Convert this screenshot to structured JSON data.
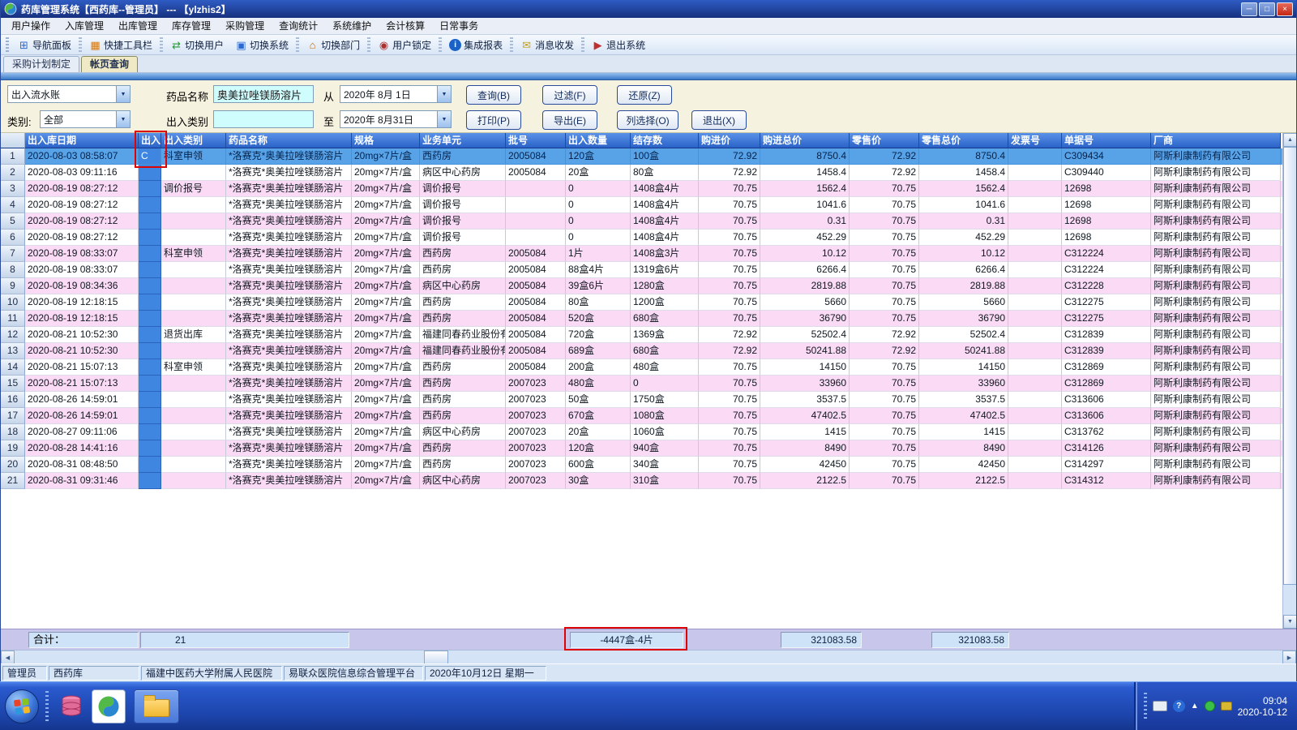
{
  "window": {
    "title": "药库管理系统【西药库--管理员】 --- 【ylzhis2】"
  },
  "icons": {
    "minimize": "─",
    "maximize": "□",
    "close": "×",
    "dropdown": "▼",
    "scroll_up": "▲",
    "scroll_down": "▼",
    "scroll_left": "◀",
    "scroll_right": "▶"
  },
  "menu": {
    "items": [
      "用户操作",
      "入库管理",
      "出库管理",
      "库存管理",
      "采购管理",
      "查询统计",
      "系统维护",
      "会计核算",
      "日常事务"
    ]
  },
  "toolbar": {
    "items": [
      {
        "name": "toolbar-nav-panel",
        "label": "导航面板",
        "icon": "nav-panel-icon",
        "glyph": "⊞",
        "color": "#2a6ad4",
        "circle": false,
        "sep_after": true
      },
      {
        "name": "toolbar-quick-tools",
        "label": "快捷工具栏",
        "icon": "quick-toolbar-icon",
        "glyph": "▦",
        "color": "#d07818",
        "circle": false,
        "sep_after": true
      },
      {
        "name": "toolbar-switch-user",
        "label": "切换用户",
        "icon": "switch-user-icon",
        "glyph": "⇄",
        "color": "#2a9a3a",
        "circle": false,
        "sep_after": false
      },
      {
        "name": "toolbar-switch-system",
        "label": "切换系统",
        "icon": "switch-system-icon",
        "glyph": "▣",
        "color": "#2a6ad4",
        "circle": false,
        "sep_after": true
      },
      {
        "name": "toolbar-switch-dept",
        "label": "切换部门",
        "icon": "switch-dept-icon",
        "glyph": "⌂",
        "color": "#c06a10",
        "circle": false,
        "sep_after": true
      },
      {
        "name": "toolbar-user-lock",
        "label": "用户锁定",
        "icon": "user-lock-icon",
        "glyph": "◉",
        "color": "#b03030",
        "circle": false,
        "sep_after": true
      },
      {
        "name": "toolbar-reports",
        "label": "集成报表",
        "icon": "report-icon",
        "glyph": "i",
        "color": "#1a62c8",
        "circle": true,
        "sep_after": true
      },
      {
        "name": "toolbar-messages",
        "label": "消息收发",
        "icon": "message-icon",
        "glyph": "✉",
        "color": "#c8a018",
        "circle": false,
        "sep_after": true
      },
      {
        "name": "toolbar-exit",
        "label": "退出系统",
        "icon": "exit-icon",
        "glyph": "▶",
        "color": "#c03030",
        "circle": false,
        "sep_after": false
      }
    ]
  },
  "tabs": [
    {
      "label": "采购计划制定",
      "active": false
    },
    {
      "label": "帐页查询",
      "active": true
    }
  ],
  "filters": {
    "ledger_type": "出入流水账",
    "category_label": "类别:",
    "category_value": "全部",
    "drug_name_label": "药品名称",
    "drug_name_value": "奥美拉唑镁肠溶片",
    "inout_type_label": "出入类别",
    "inout_type_value": "",
    "from_label": "从",
    "from_date": "2020年  8月 1日",
    "to_label": "至",
    "to_date": "2020年  8月31日",
    "buttons_row1": [
      "查询(B)",
      "过滤(F)",
      "还原(Z)"
    ],
    "buttons_row2": [
      "打印(P)",
      "导出(E)",
      "列选择(O)",
      "退出(X)"
    ]
  },
  "table": {
    "columns": [
      "出入库日期",
      "出入",
      "出入类别",
      "药品名称",
      "规格",
      "业务单元",
      "批号",
      "出入数量",
      "结存数",
      "购进价",
      "购进总价",
      "零售价",
      "零售总价",
      "发票号",
      "单据号",
      "厂商"
    ],
    "rows": [
      [
        "2020-08-03 08:58:07",
        "C",
        "科室申领",
        "*洛赛克*奥美拉唑镁肠溶片",
        "20mg×7片/盒",
        "西药房",
        "2005084",
        "120盒",
        "100盒",
        "72.92",
        "8750.4",
        "72.92",
        "8750.4",
        "",
        "C309434",
        "阿斯利康制药有限公司"
      ],
      [
        "2020-08-03 09:11:16",
        "",
        "",
        "*洛赛克*奥美拉唑镁肠溶片",
        "20mg×7片/盒",
        "病区中心药房",
        "2005084",
        "20盒",
        "80盒",
        "72.92",
        "1458.4",
        "72.92",
        "1458.4",
        "",
        "C309440",
        "阿斯利康制药有限公司"
      ],
      [
        "2020-08-19 08:27:12",
        "",
        "调价报号",
        "*洛赛克*奥美拉唑镁肠溶片",
        "20mg×7片/盒",
        "调价报号",
        "",
        "0",
        "1408盒4片",
        "70.75",
        "1562.4",
        "70.75",
        "1562.4",
        "",
        "12698",
        "阿斯利康制药有限公司"
      ],
      [
        "2020-08-19 08:27:12",
        "",
        "",
        "*洛赛克*奥美拉唑镁肠溶片",
        "20mg×7片/盒",
        "调价报号",
        "",
        "0",
        "1408盒4片",
        "70.75",
        "1041.6",
        "70.75",
        "1041.6",
        "",
        "12698",
        "阿斯利康制药有限公司"
      ],
      [
        "2020-08-19 08:27:12",
        "",
        "",
        "*洛赛克*奥美拉唑镁肠溶片",
        "20mg×7片/盒",
        "调价报号",
        "",
        "0",
        "1408盒4片",
        "70.75",
        "0.31",
        "70.75",
        "0.31",
        "",
        "12698",
        "阿斯利康制药有限公司"
      ],
      [
        "2020-08-19 08:27:12",
        "",
        "",
        "*洛赛克*奥美拉唑镁肠溶片",
        "20mg×7片/盒",
        "调价报号",
        "",
        "0",
        "1408盒4片",
        "70.75",
        "452.29",
        "70.75",
        "452.29",
        "",
        "12698",
        "阿斯利康制药有限公司"
      ],
      [
        "2020-08-19 08:33:07",
        "",
        "科室申领",
        "*洛赛克*奥美拉唑镁肠溶片",
        "20mg×7片/盒",
        "西药房",
        "2005084",
        "1片",
        "1408盒3片",
        "70.75",
        "10.12",
        "70.75",
        "10.12",
        "",
        "C312224",
        "阿斯利康制药有限公司"
      ],
      [
        "2020-08-19 08:33:07",
        "",
        "",
        "*洛赛克*奥美拉唑镁肠溶片",
        "20mg×7片/盒",
        "西药房",
        "2005084",
        "88盒4片",
        "1319盒6片",
        "70.75",
        "6266.4",
        "70.75",
        "6266.4",
        "",
        "C312224",
        "阿斯利康制药有限公司"
      ],
      [
        "2020-08-19 08:34:36",
        "",
        "",
        "*洛赛克*奥美拉唑镁肠溶片",
        "20mg×7片/盒",
        "病区中心药房",
        "2005084",
        "39盒6片",
        "1280盒",
        "70.75",
        "2819.88",
        "70.75",
        "2819.88",
        "",
        "C312228",
        "阿斯利康制药有限公司"
      ],
      [
        "2020-08-19 12:18:15",
        "",
        "",
        "*洛赛克*奥美拉唑镁肠溶片",
        "20mg×7片/盒",
        "西药房",
        "2005084",
        "80盒",
        "1200盒",
        "70.75",
        "5660",
        "70.75",
        "5660",
        "",
        "C312275",
        "阿斯利康制药有限公司"
      ],
      [
        "2020-08-19 12:18:15",
        "",
        "",
        "*洛赛克*奥美拉唑镁肠溶片",
        "20mg×7片/盒",
        "西药房",
        "2005084",
        "520盒",
        "680盒",
        "70.75",
        "36790",
        "70.75",
        "36790",
        "",
        "C312275",
        "阿斯利康制药有限公司"
      ],
      [
        "2020-08-21 10:52:30",
        "",
        "退货出库",
        "*洛赛克*奥美拉唑镁肠溶片",
        "20mg×7片/盒",
        "福建同春药业股份有限公司",
        "2005084",
        "720盒",
        "1369盒",
        "72.92",
        "52502.4",
        "72.92",
        "52502.4",
        "",
        "C312839",
        "阿斯利康制药有限公司"
      ],
      [
        "2020-08-21 10:52:30",
        "",
        "",
        "*洛赛克*奥美拉唑镁肠溶片",
        "20mg×7片/盒",
        "福建同春药业股份有限公司",
        "2005084",
        "689盒",
        "680盒",
        "72.92",
        "50241.88",
        "72.92",
        "50241.88",
        "",
        "C312839",
        "阿斯利康制药有限公司"
      ],
      [
        "2020-08-21 15:07:13",
        "",
        "科室申领",
        "*洛赛克*奥美拉唑镁肠溶片",
        "20mg×7片/盒",
        "西药房",
        "2005084",
        "200盒",
        "480盒",
        "70.75",
        "14150",
        "70.75",
        "14150",
        "",
        "C312869",
        "阿斯利康制药有限公司"
      ],
      [
        "2020-08-21 15:07:13",
        "",
        "",
        "*洛赛克*奥美拉唑镁肠溶片",
        "20mg×7片/盒",
        "西药房",
        "2007023",
        "480盒",
        "0",
        "70.75",
        "33960",
        "70.75",
        "33960",
        "",
        "C312869",
        "阿斯利康制药有限公司"
      ],
      [
        "2020-08-26 14:59:01",
        "",
        "",
        "*洛赛克*奥美拉唑镁肠溶片",
        "20mg×7片/盒",
        "西药房",
        "2007023",
        "50盒",
        "1750盒",
        "70.75",
        "3537.5",
        "70.75",
        "3537.5",
        "",
        "C313606",
        "阿斯利康制药有限公司"
      ],
      [
        "2020-08-26 14:59:01",
        "",
        "",
        "*洛赛克*奥美拉唑镁肠溶片",
        "20mg×7片/盒",
        "西药房",
        "2007023",
        "670盒",
        "1080盒",
        "70.75",
        "47402.5",
        "70.75",
        "47402.5",
        "",
        "C313606",
        "阿斯利康制药有限公司"
      ],
      [
        "2020-08-27 09:11:06",
        "",
        "",
        "*洛赛克*奥美拉唑镁肠溶片",
        "20mg×7片/盒",
        "病区中心药房",
        "2007023",
        "20盒",
        "1060盒",
        "70.75",
        "1415",
        "70.75",
        "1415",
        "",
        "C313762",
        "阿斯利康制药有限公司"
      ],
      [
        "2020-08-28 14:41:16",
        "",
        "",
        "*洛赛克*奥美拉唑镁肠溶片",
        "20mg×7片/盒",
        "西药房",
        "2007023",
        "120盒",
        "940盒",
        "70.75",
        "8490",
        "70.75",
        "8490",
        "",
        "C314126",
        "阿斯利康制药有限公司"
      ],
      [
        "2020-08-31 08:48:50",
        "",
        "",
        "*洛赛克*奥美拉唑镁肠溶片",
        "20mg×7片/盒",
        "西药房",
        "2007023",
        "600盒",
        "340盒",
        "70.75",
        "42450",
        "70.75",
        "42450",
        "",
        "C314297",
        "阿斯利康制药有限公司"
      ],
      [
        "2020-08-31 09:31:46",
        "",
        "",
        "*洛赛克*奥美拉唑镁肠溶片",
        "20mg×7片/盒",
        "病区中心药房",
        "2007023",
        "30盒",
        "310盒",
        "70.75",
        "2122.5",
        "70.75",
        "2122.5",
        "",
        "C314312",
        "阿斯利康制药有限公司"
      ]
    ]
  },
  "footer": {
    "label": "合计：",
    "record_count": "21",
    "quantity_total": "-4447盒-4片",
    "purchase_total": "321083.58",
    "retail_total": "321083.58"
  },
  "statusbar": {
    "items": [
      "管理员",
      "西药库",
      "福建中医药大学附属人民医院",
      "易联众医院信息综合管理平台",
      "2020年10月12日 星期一"
    ]
  },
  "taskbar": {
    "clock_time": "09:04",
    "clock_date": "2020-10-12"
  },
  "colors": {
    "annotation": "#dd0404",
    "selected_row": "#58a2e8",
    "alt_row": "#fadaf4",
    "header_blue": "#2a62c8",
    "inout_column": "#3f86e0"
  }
}
